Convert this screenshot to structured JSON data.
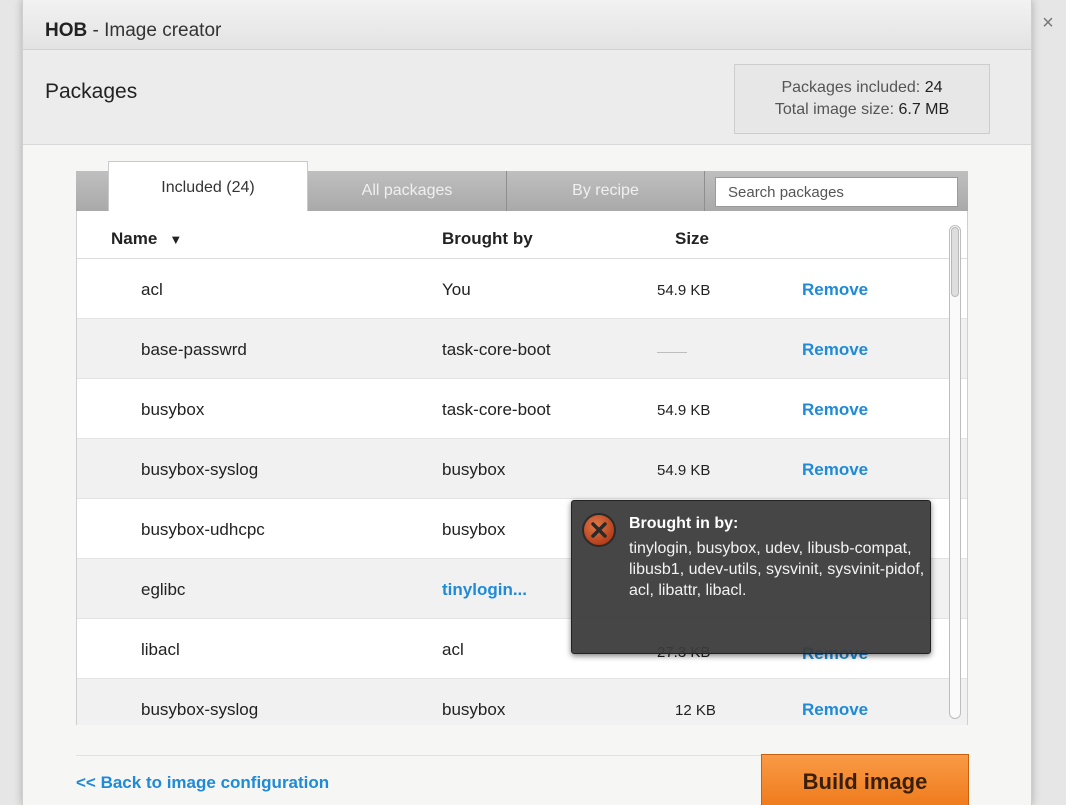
{
  "window": {
    "app_name": "HOB",
    "title_suffix": " - Image creator",
    "close_glyph": "×"
  },
  "header": {
    "title": "Packages",
    "packages_included_label": "Packages included:",
    "packages_included_value": "24",
    "total_size_label": "Total image size:",
    "total_size_value": "6.7 MB"
  },
  "tabs": [
    {
      "label": "Included (24)",
      "active": true
    },
    {
      "label": "All packages",
      "active": false
    },
    {
      "label": "By recipe",
      "active": false
    }
  ],
  "search": {
    "placeholder": "Search packages"
  },
  "table": {
    "columns": {
      "name": "Name",
      "brought_by": "Brought by",
      "size": "Size"
    },
    "sort_icon": "sort-descending-icon",
    "rows": [
      {
        "name": "acl",
        "brought_by": "You",
        "size": "54.9 KB",
        "action": "Remove"
      },
      {
        "name": "base-passwrd",
        "brought_by": "task-core-boot",
        "size": "",
        "action": "Remove"
      },
      {
        "name": "busybox",
        "brought_by": "task-core-boot",
        "size": "54.9 KB",
        "action": "Remove"
      },
      {
        "name": "busybox-syslog",
        "brought_by": "busybox",
        "size": "54.9 KB",
        "action": "Remove"
      },
      {
        "name": "busybox-udhcpc",
        "brought_by": "busybox",
        "size": "",
        "action": ""
      },
      {
        "name": "eglibc",
        "brought_by": "tinylogin...",
        "size": "",
        "action": ""
      },
      {
        "name": "libacl",
        "brought_by": "acl",
        "size": "27.3 KB",
        "action": "Remove"
      },
      {
        "name": "busybox-syslog",
        "brought_by": "busybox",
        "size": "12 KB",
        "action": "Remove"
      }
    ]
  },
  "tooltip": {
    "icon": "error-icon",
    "title": "Brought in by:",
    "body": "tinylogin, busybox, udev, libusb-compat, libusb1, udev-utils, sysvinit, sysvinit-pidof, acl, libattr, libacl."
  },
  "footer": {
    "back_label": "<< Back to image configuration",
    "build_label": "Build image"
  },
  "colors": {
    "link": "#1e8ad8",
    "build_button": "#ef7a1b",
    "tooltip_bg": "#3a3a3a"
  }
}
